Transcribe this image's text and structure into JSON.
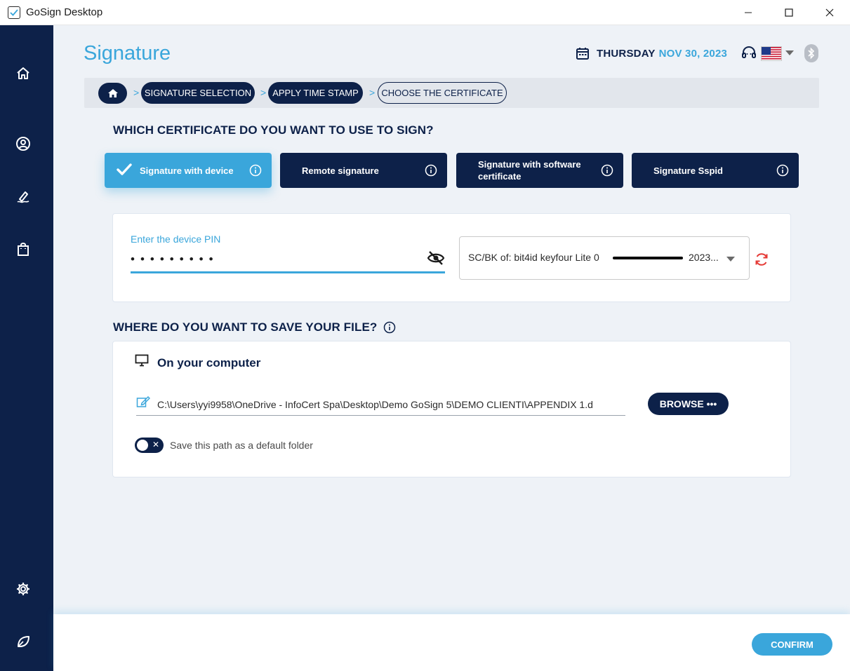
{
  "window": {
    "title": "GoSign Desktop",
    "controls": [
      "minimize-icon",
      "maximize-icon",
      "close-icon"
    ]
  },
  "sidebar": {
    "items": [
      {
        "icon": "home-icon"
      },
      {
        "icon": "user-icon"
      },
      {
        "icon": "sign-pen-icon"
      },
      {
        "icon": "shopping-bag-icon"
      },
      {
        "icon": "gear-icon"
      },
      {
        "icon": "leaf-icon"
      }
    ]
  },
  "header": {
    "title": "Signature",
    "date_day": "THURSDAY",
    "date_value": "NOV 30, 2023",
    "language_flag": "us-flag-icon"
  },
  "breadcrumb": {
    "items": [
      "SIGNATURE SELECTION",
      "APPLY TIME STAMP",
      "CHOOSE THE CERTIFICATE"
    ]
  },
  "certificate": {
    "question": "WHICH CERTIFICATE DO YOU WANT TO USE TO SIGN?",
    "options": [
      {
        "label": "Signature with device",
        "active": true
      },
      {
        "label": "Remote signature",
        "active": false
      },
      {
        "label": "Signature with software certificate",
        "active": false
      },
      {
        "label": "Signature Sspid",
        "active": false
      }
    ]
  },
  "pin": {
    "label": "Enter the device PIN",
    "value": "•••••••••",
    "device_select": "SC/BK of: bit4id keyfour Lite 0",
    "device_select_suffix": "2023..."
  },
  "save": {
    "question": "WHERE DO YOU WANT TO SAVE YOUR FILE?",
    "location": "On your computer",
    "path": "C:\\Users\\yyi9958\\OneDrive - InfoCert Spa\\Desktop\\Demo GoSign 5\\DEMO CLIENTI\\APPENDIX 1.d",
    "browse_label": "BROWSE •••",
    "default_toggle_label": "Save this path as a default folder",
    "default_toggle_on": false
  },
  "footer": {
    "confirm_label": "CONFIRM"
  },
  "colors": {
    "navy": "#0d2149",
    "accent": "#3aa6db",
    "background": "#eef2f7",
    "refresh": "#e53935"
  }
}
